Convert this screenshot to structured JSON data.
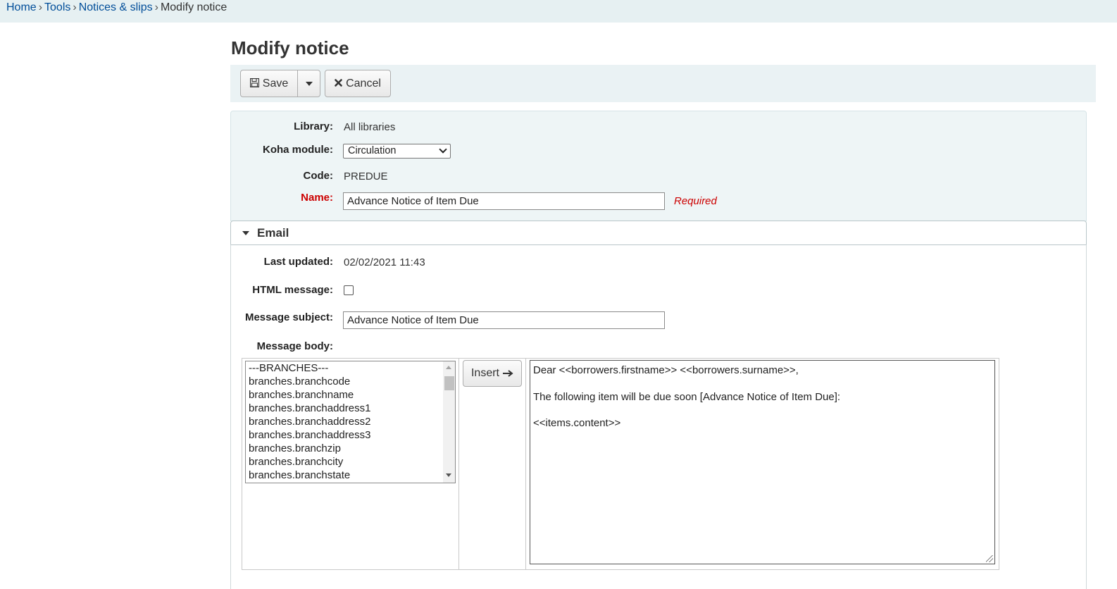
{
  "breadcrumbs": {
    "home": "Home",
    "tools": "Tools",
    "notices": "Notices & slips",
    "current": "Modify notice",
    "separator": "›"
  },
  "page_title": "Modify notice",
  "toolbar": {
    "save_label": "Save",
    "cancel_label": "Cancel"
  },
  "form": {
    "library_label": "Library:",
    "library_value": "All libraries",
    "module_label": "Koha module:",
    "module_value": "Circulation",
    "code_label": "Code:",
    "code_value": "PREDUE",
    "name_label": "Name:",
    "name_value": "Advance Notice of Item Due",
    "required_note": "Required"
  },
  "email": {
    "section_title": "Email",
    "last_updated_label": "Last updated:",
    "last_updated_value": "02/02/2021 11:43",
    "html_message_label": "HTML message:",
    "html_message_checked": false,
    "subject_label": "Message subject:",
    "subject_value": "Advance Notice of Item Due",
    "body_label": "Message body:",
    "insert_label": "Insert",
    "fields_list": [
      "---BRANCHES---",
      "branches.branchcode",
      "branches.branchname",
      "branches.branchaddress1",
      "branches.branchaddress2",
      "branches.branchaddress3",
      "branches.branchzip",
      "branches.branchcity",
      "branches.branchstate"
    ],
    "body_lines": [
      "Dear <<borrowers.firstname>> <<borrowers.surname>>,",
      "",
      "The following item will be due soon [Advance Notice of Item Due]:",
      "",
      "<<items.content>>"
    ]
  },
  "colors": {
    "link": "#004d99",
    "required": "#cc0000",
    "toolbar_bg": "#eaf2f4",
    "fieldset_bg": "#eef5f6"
  }
}
